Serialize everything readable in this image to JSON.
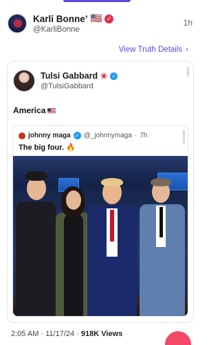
{
  "post": {
    "author_name": "Karli Bonne’",
    "author_flag": "🇺🇸",
    "author_handle": "@KarliBonne",
    "time": "1h",
    "view_link": "View Truth Details",
    "colors": {
      "accent": "#5b46e0",
      "badge": "#e0314b"
    }
  },
  "quote": {
    "author_name": "Tulsi Gabbard",
    "author_handle": "@TulsiGabbard",
    "text": "America"
  },
  "inner": {
    "author_name": "johnny maga",
    "handle": "@_johnnymaga",
    "time": "7h",
    "text": "The big four."
  },
  "footer": {
    "date": "2:05 AM · 11/17/24 · ",
    "views": "918K Views"
  }
}
